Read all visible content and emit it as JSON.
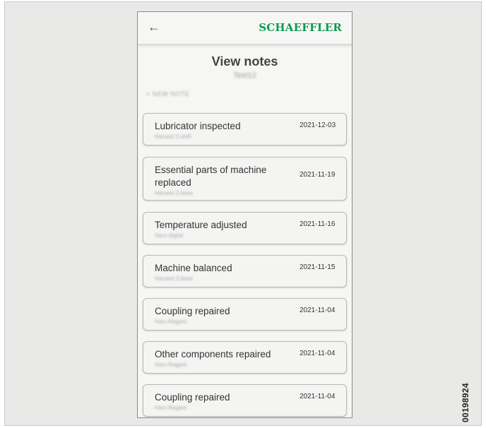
{
  "document_id": "00198924",
  "header": {
    "brand": "SCHAEFFLER",
    "back_icon": "arrow-left-icon",
    "brand_color": "#0c9a52"
  },
  "page": {
    "title": "View notes",
    "subtitle": "Test12",
    "new_note_label": "+ NEW NOTE"
  },
  "notes": [
    {
      "title": "Lubricator inspected",
      "subtitle": "Harvest 2-shift",
      "date": "2021-12-03"
    },
    {
      "title": "Essential parts of machine replaced",
      "subtitle": "Harvest 2-base",
      "date": "2021-11-19"
    },
    {
      "title": "Temperature adjusted",
      "subtitle": "Harv-digital",
      "date": "2021-11-16"
    },
    {
      "title": "Machine balanced",
      "subtitle": "Harvest 2-base",
      "date": "2021-11-15"
    },
    {
      "title": "Coupling repaired",
      "subtitle": "Harv-Regent",
      "date": "2021-11-04"
    },
    {
      "title": "Other components repaired",
      "subtitle": "Harv-Regent",
      "date": "2021-11-04"
    },
    {
      "title": "Coupling repaired",
      "subtitle": "Harv-Regent",
      "date": "2021-11-04"
    }
  ]
}
